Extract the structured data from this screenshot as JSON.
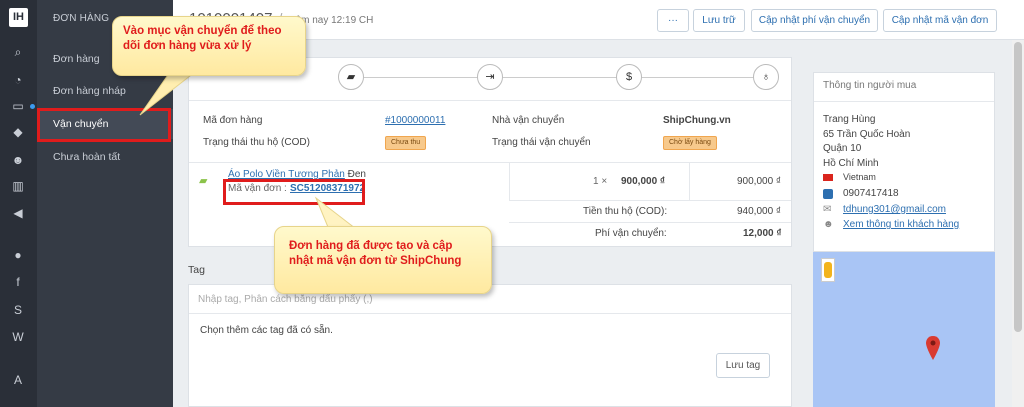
{
  "sidebar": {
    "logo_text": "IH",
    "section_title": "ĐƠN HÀNG",
    "items": [
      "Đơn hàng",
      "Đơn hàng nháp",
      "Vận chuyển",
      "Chưa hoàn tất"
    ],
    "icons": [
      "search-icon",
      "dashboard-icon",
      "inbox-icon",
      "tag-icon",
      "users-icon",
      "chart-icon",
      "megaphone-icon",
      "globe-icon",
      "facebook-icon",
      "s-icon",
      "w-icon",
      "brand-icon"
    ]
  },
  "header": {
    "order_number": "1010001407",
    "time": "Hôm nay 12:19 CH",
    "more_label": "···",
    "archive_label": "Lưu trữ",
    "update_fee_label": "Cập nhật phí vận chuyển",
    "update_code_label": "Cập nhật mã vận đơn"
  },
  "shipment": {
    "order_code_label": "Mã đơn hàng",
    "order_code_value": "#1000000011",
    "carrier_label": "Nhà vận chuyển",
    "carrier_value": "ShipChung.vn",
    "cod_status_label": "Trạng thái thu hộ (COD)",
    "cod_status_value": "Chưa thu",
    "ship_status_label": "Trạng thái vận chuyển",
    "ship_status_value": "Chờ lấy hàng",
    "product_name": "Áo Polo Viền Tương Phản",
    "product_variant": "Đen",
    "tracking_label": "Mã vận đơn :",
    "tracking_value": "SC51208371972",
    "qty_expr": "1  ×",
    "unit_price": "900,000 ₫",
    "line_total": "900,000 ₫",
    "cod_total_label": "Tiền thu hộ (COD):",
    "cod_total_value": "940,000 ₫",
    "ship_fee_label": "Phí vận chuyển:",
    "ship_fee_value": "12,000 ₫"
  },
  "tags": {
    "title": "Tag",
    "input_placeholder": "Nhập tag, Phân cách bằng dấu phẩy (,)",
    "hint": "Chọn thêm các tag đã có sẵn.",
    "save_label": "Lưu tag"
  },
  "buyer": {
    "title": "Thông tin người mua",
    "name": "Trang Hùng",
    "address1": "65 Trần Quốc Hoàn",
    "address2": "Quận 10",
    "city": "Hồ Chí Minh",
    "country": "Vietnam",
    "phone": "0907417418",
    "email": "tdhung301@gmail.com",
    "view_customer": "Xem thông tin khách hàng"
  },
  "callouts": {
    "top": "Vào mục vận chuyển để theo dõi đơn hàng vừa xử lý",
    "bottom": "Đơn hàng đã được tạo và cập nhật mã vận đơn từ ShipChung"
  },
  "colors": {
    "accent": "#2d6fb0",
    "annotation_red": "#e01c1c",
    "sidebar": "#353b45"
  }
}
